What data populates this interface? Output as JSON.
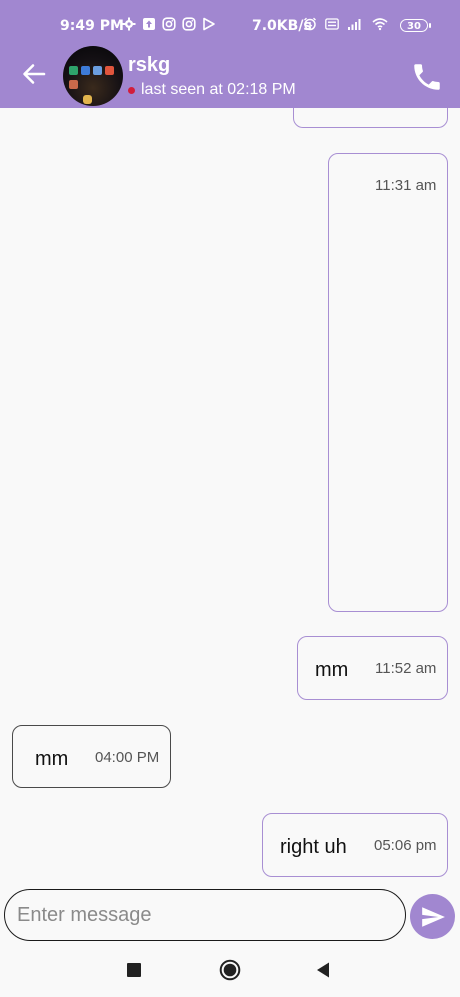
{
  "status_bar": {
    "time": "9:49 PM",
    "network_speed": "7.0KB/s",
    "battery": "30",
    "icons_left": [
      "gear-icon",
      "upload-icon",
      "instagram-icon",
      "instagram-icon",
      "play-store-icon"
    ],
    "icons_right": [
      "alarm-icon",
      "volte-icon",
      "signal-icon",
      "wifi-icon"
    ]
  },
  "header": {
    "back_icon": "arrow-left-icon",
    "contact_name": "rskg",
    "last_seen": "last seen at 02:18 PM",
    "call_icon": "phone-icon",
    "online_dot_color": "#d21d3b"
  },
  "messages": [
    {
      "direction": "outgoing",
      "text": "",
      "time": ""
    },
    {
      "direction": "outgoing",
      "text": "",
      "time": "11:31 am"
    },
    {
      "direction": "outgoing",
      "text": "mm",
      "time": "11:52 am"
    },
    {
      "direction": "incoming",
      "text": "mm",
      "time": "04:00 PM"
    },
    {
      "direction": "outgoing",
      "text": "right uh",
      "time": "05:06 pm"
    }
  ],
  "composer": {
    "placeholder": "Enter message",
    "value": "",
    "send_icon": "send-icon"
  },
  "nav_bar": {
    "icons": [
      "recents-square-icon",
      "home-circle-icon",
      "back-triangle-icon"
    ]
  },
  "colors": {
    "accent": "#a187d0",
    "outgoing_border": "#a88fd3",
    "incoming_border": "#4a4a4a",
    "background": "#f9f9f9"
  }
}
